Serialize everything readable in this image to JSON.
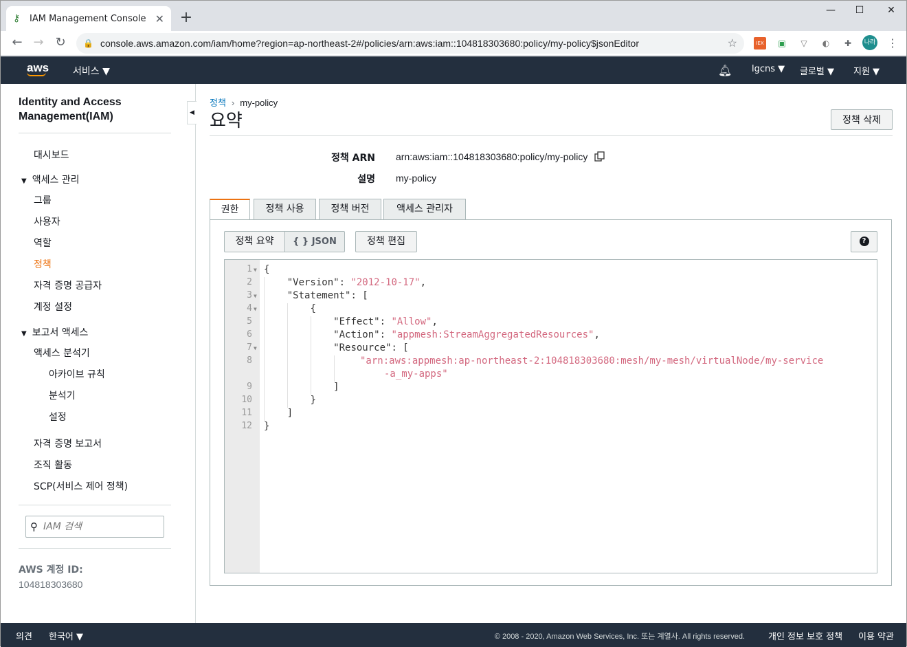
{
  "browser": {
    "tab_title": "IAM Management Console",
    "url": "console.aws.amazon.com/iam/home?region=ap-northeast-2#/policies/arn:aws:iam::104818303680:policy/my-policy$jsonEditor",
    "avatar_label": "나라",
    "ext_label": "IEX"
  },
  "nav": {
    "logo": "aws",
    "services": "서비스 ▼",
    "user": "lgcns ▼",
    "region": "글로벌 ▼",
    "support": "지원 ▼"
  },
  "sidebar": {
    "title": "Identity and Access Management(IAM)",
    "dashboard": "대시보드",
    "access_mgmt": "액세스 관리",
    "groups": "그룹",
    "users": "사용자",
    "roles": "역할",
    "policies": "정책",
    "identity_providers": "자격 증명 공급자",
    "account_settings": "계정 설정",
    "reports_access": "보고서 액세스",
    "access_analyzer": "액세스 분석기",
    "archive_rules": "아카이브 규칙",
    "analyzers": "분석기",
    "settings": "설정",
    "credential_report": "자격 증명 보고서",
    "org_activity": "조직 활동",
    "scp": "SCP(서비스 제어 정책)",
    "search_placeholder": "IAM 검색",
    "account_id_label": "AWS 계정 ID:",
    "account_id": "104818303680"
  },
  "main": {
    "breadcrumb_parent": "정책",
    "breadcrumb_current": "my-policy",
    "title": "요약",
    "delete_button": "정책 삭제",
    "arn_label": "정책 ARN",
    "arn_value": "arn:aws:iam::104818303680:policy/my-policy",
    "desc_label": "설명",
    "desc_value": "my-policy",
    "tabs": [
      "권한",
      "정책 사용",
      "정책 버전",
      "액세스 관리자"
    ],
    "summary_button": "정책 요약",
    "json_button": "{ } JSON",
    "edit_button": "정책 편집"
  },
  "editor": {
    "line_numbers": [
      "1",
      "2",
      "3",
      "4",
      "5",
      "6",
      "7",
      "8",
      "9",
      "10",
      "11",
      "12"
    ],
    "l1": "{",
    "l2_key": "\"Version\"",
    "l2_val": "\"2012-10-17\"",
    "l3_key": "\"Statement\"",
    "l4": "{",
    "l5_key": "\"Effect\"",
    "l5_val": "\"Allow\"",
    "l6_key": "\"Action\"",
    "l6_val": "\"appmesh:StreamAggregatedResources\"",
    "l7_key": "\"Resource\"",
    "l8a": "\"arn:aws:appmesh:ap-northeast-2:104818303680:mesh/my-mesh/virtualNode/my-service",
    "l8b": "-a_my-apps\"",
    "l9": "]",
    "l10": "}",
    "l11": "]",
    "l12": "}"
  },
  "footer": {
    "feedback": "의견",
    "language": "한국어 ▼",
    "copyright": "© 2008 - 2020, Amazon Web Services, Inc. 또는 계열사. All rights reserved.",
    "privacy": "개인 정보 보호 정책",
    "terms": "이용 약관"
  }
}
